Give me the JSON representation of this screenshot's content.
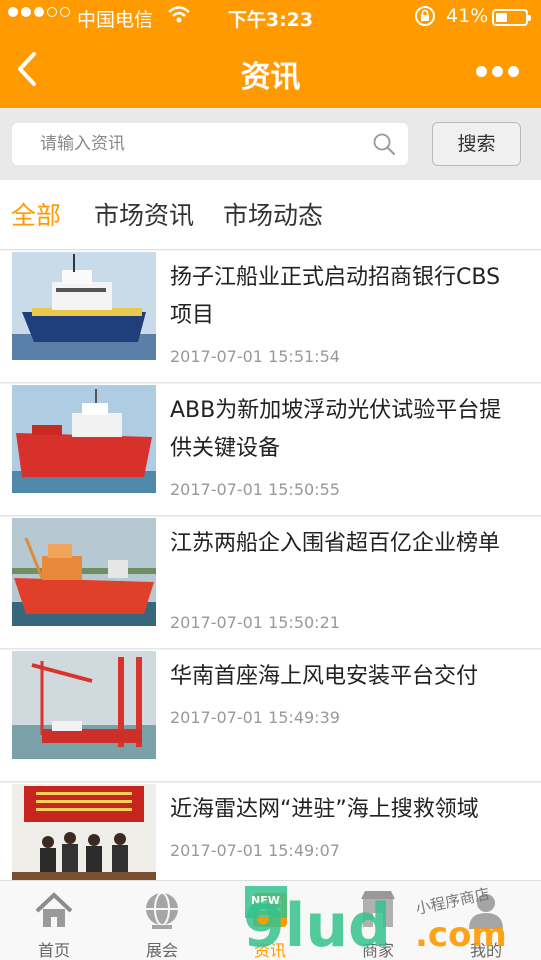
{
  "status": {
    "carrier": "中国电信",
    "time": "下午3:23",
    "battery_text": "41%",
    "battery_level": 0.41
  },
  "nav": {
    "title": "资讯"
  },
  "search": {
    "placeholder": "请输入资讯",
    "button": "搜索"
  },
  "tabs": [
    "全部",
    "市场资讯",
    "市场动态"
  ],
  "articles": [
    {
      "title": "扬子江船业正式启动招商银行CBS项目",
      "date": "2017-07-01 15:51:54"
    },
    {
      "title": "ABB为新加坡浮动光伏试验平台提供关键设备",
      "date": "2017-07-01 15:50:55"
    },
    {
      "title": "江苏两船企入围省超百亿企业榜单",
      "date": "2017-07-01 15:50:21"
    },
    {
      "title": "华南首座海上风电安装平台交付",
      "date": "2017-07-01 15:49:39"
    },
    {
      "title": "近海雷达网“进驻”海上搜救领域",
      "date": "2017-07-01 15:49:07"
    }
  ],
  "tabbar": [
    "首页",
    "展会",
    "资讯",
    "商家",
    "我的"
  ],
  "watermark": {
    "logo": "9lud",
    "domain": ".com",
    "tagline": "小程序商店",
    "badge": "NEW"
  },
  "colors": {
    "accent": "#ff9a00"
  }
}
